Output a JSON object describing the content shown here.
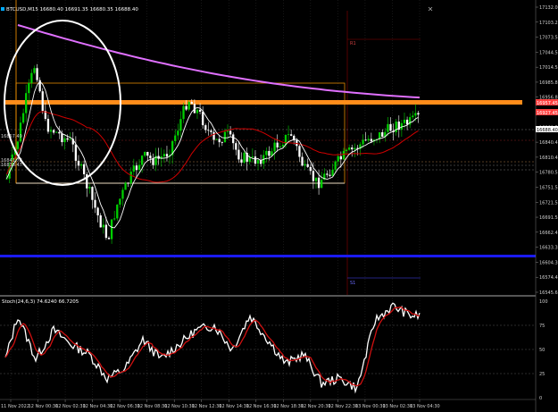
{
  "window": {
    "title": "BTCUSD,M15",
    "quote_line": "BTCUSD,M15  16680.40 16691.35 16680.35 16688.40",
    "close_icon": "close-icon"
  },
  "colors": {
    "background": "#000000",
    "bull": "#00d000",
    "bear": "#ffffff",
    "ma_fast": "#ffffff",
    "ma_mid": "#d00000",
    "ma_slow": "#e070ff",
    "resistance_band": "#ff8c1a",
    "support_line": "#0000ff",
    "stoch_main": "#ffffff",
    "stoch_signal": "#d01010",
    "grid": "#3a3a3a",
    "highlight_ellipse": "#ffffff",
    "session_marker": "#8b0000",
    "trend_line": "#ff9900"
  },
  "price_axis": {
    "labels": [
      "17132.05",
      "17103.25",
      "17073.50",
      "17044.50",
      "17014.50",
      "16985.85",
      "16956.85",
      "16927.45",
      "16869.55",
      "16840.45",
      "16810.45",
      "16780.55",
      "16751.50",
      "16721.50",
      "16691.55",
      "16662.45",
      "16633.35",
      "16604.30",
      "16574.45",
      "16545.65"
    ],
    "current_price": "16688.40",
    "resistance_tag": "16957.45",
    "ask_tag": "16927.45"
  },
  "level_labels": {
    "r1": "R1",
    "s1": "S1"
  },
  "stoch_panel": {
    "title": "Stoch(24,6,3) 74.6240 66.7205",
    "levels": [
      "100",
      "75",
      "50",
      "25",
      "0"
    ]
  },
  "time_axis": {
    "labels": [
      "11 Nov 2022",
      "12 Nov 00:30",
      "12 Nov 02:30",
      "12 Nov 04:30",
      "12 Nov 06:30",
      "12 Nov 08:30",
      "12 Nov 10:30",
      "12 Nov 12:30",
      "12 Nov 14:30",
      "12 Nov 16:30",
      "12 Nov 18:30",
      "12 Nov 20:30",
      "12 Nov 22:30",
      "13 Nov 00:30",
      "13 Nov 02:30",
      "13 Nov 04:30"
    ]
  },
  "ma_labels": {
    "a": "16857.49",
    "b": "16841.78",
    "c": "16838.47"
  }
}
